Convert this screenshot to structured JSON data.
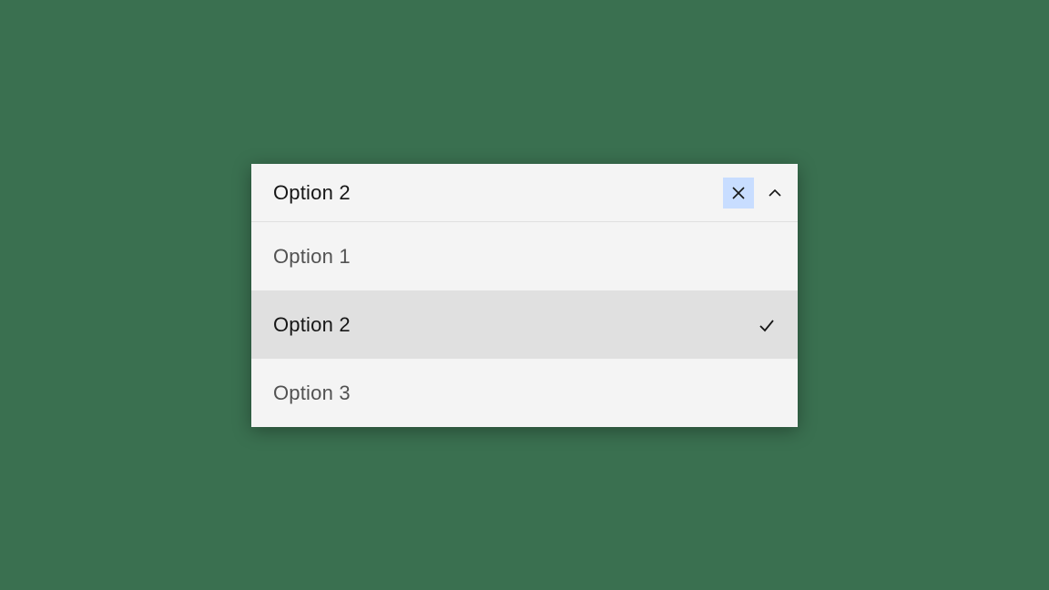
{
  "combobox": {
    "selected_label": "Option 2",
    "selected_index": 1,
    "options": [
      {
        "label": "Option 1"
      },
      {
        "label": "Option 2"
      },
      {
        "label": "Option 3"
      }
    ],
    "colors": {
      "panel_bg": "#f4f4f4",
      "item_selected_bg": "#e0e0e0",
      "clear_bg": "#c8ddff",
      "text_primary": "#161616",
      "text_secondary": "#525252"
    }
  }
}
